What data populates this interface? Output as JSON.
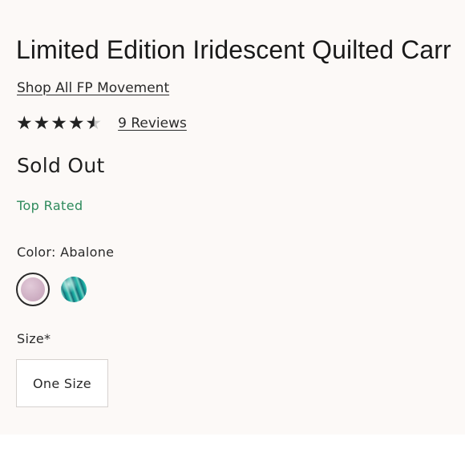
{
  "product": {
    "title": "Limited Edition Iridescent Quilted Carr",
    "collection_link": "Shop All FP Movement",
    "rating": {
      "stars": 4.5,
      "max": 5,
      "reviews_text": "9 Reviews"
    },
    "status": "Sold Out",
    "badge": "Top Rated"
  },
  "color": {
    "label": "Color: Abalone",
    "swatches": [
      {
        "name": "Abalone",
        "selected": true,
        "color": "#d4b7c8"
      },
      {
        "name": "teal-iridescent",
        "selected": false,
        "color": "#1a8f92"
      }
    ]
  },
  "size": {
    "label": "Size*",
    "options": [
      {
        "label": "One Size"
      }
    ]
  },
  "theme": {
    "background": "#fcf9f7",
    "accent_green": "#2e8a5c"
  }
}
